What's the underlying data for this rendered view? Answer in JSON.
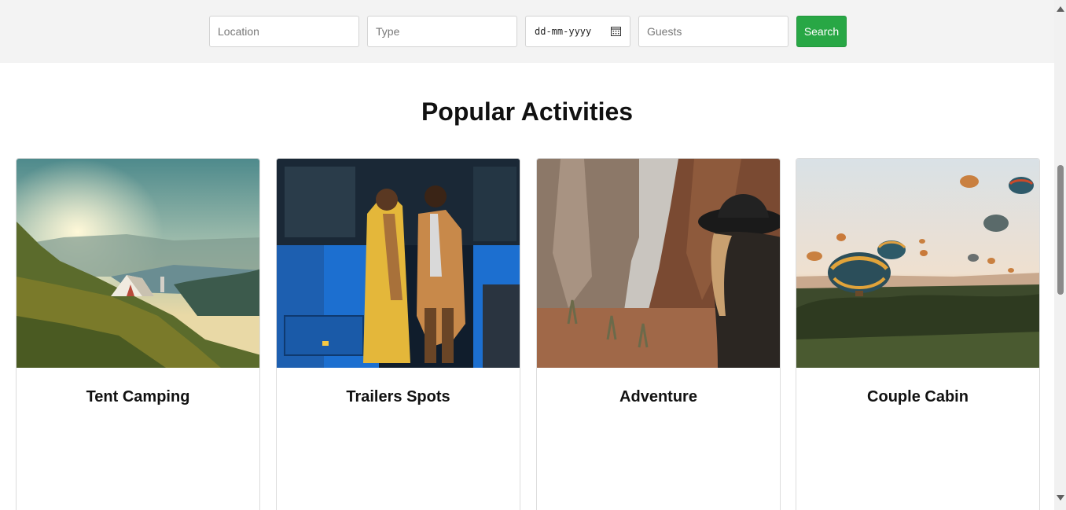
{
  "search": {
    "location_placeholder": "Location",
    "type_placeholder": "Type",
    "date_placeholder": "dd-mm-yyyy",
    "guests_placeholder": "Guests",
    "button_label": "Search",
    "button_color": "#28a745"
  },
  "section": {
    "title": "Popular Activities"
  },
  "cards": [
    {
      "title": "Tent Camping",
      "image": "mountain-tent-sunrise"
    },
    {
      "title": "Trailers Spots",
      "image": "couple-leaving-blue-bus"
    },
    {
      "title": "Adventure",
      "image": "canyon-woman-hat"
    },
    {
      "title": "Couple Cabin",
      "image": "hot-air-balloons"
    }
  ]
}
